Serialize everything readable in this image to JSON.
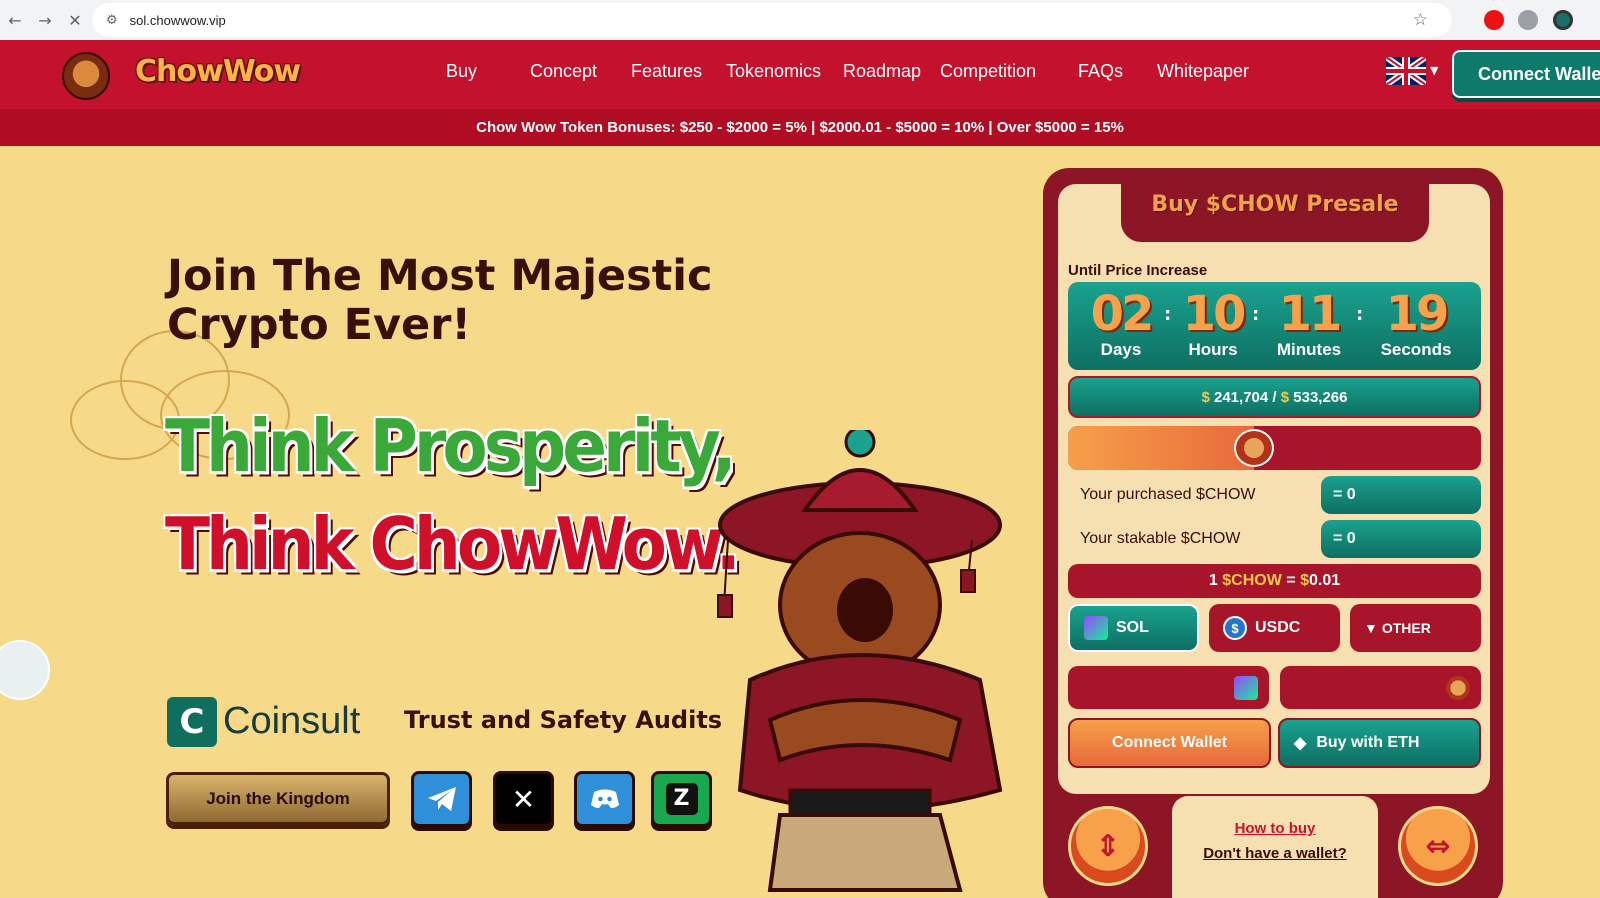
{
  "browser": {
    "url": "sol.chowwow.vip"
  },
  "header": {
    "logo_text": "ChowWow",
    "nav": [
      "Buy",
      "Concept",
      "Features",
      "Tokenomics",
      "Roadmap",
      "Competition",
      "FAQs",
      "Whitepaper"
    ],
    "connect_label": "Connect Wallet",
    "bonus_text": "Chow Wow Token Bonuses: $250 - $2000 = 5% | $2000.01 - $5000 = 10% | Over $5000 = 15%"
  },
  "hero": {
    "title": "Join The Most Majestic Crypto Ever!",
    "slogan_1": "Think Prosperity,",
    "slogan_2": "Think ChowWow.",
    "audit_brand": "Coinsult",
    "audit_text": "Trust and Safety Audits",
    "join_label": "Join the Kingdom",
    "socials": [
      "telegram",
      "x",
      "discord",
      "zealy"
    ]
  },
  "presale": {
    "title": "Buy $CHOW Presale",
    "until_label": "Until Price Increase",
    "countdown": [
      {
        "value": "02",
        "label": "Days"
      },
      {
        "value": "10",
        "label": "Hours"
      },
      {
        "value": "11",
        "label": "Minutes"
      },
      {
        "value": "19",
        "label": "Seconds"
      }
    ],
    "raised_symbol": "$",
    "raised": "241,704",
    "target": "533,266",
    "progress_fraction": 0.45,
    "purchased_label": "Your purchased $CHOW",
    "purchased_value": "= 0",
    "stakable_label": "Your stakable $CHOW",
    "stakable_value": "= 0",
    "price_prefix": "1",
    "price_token": "$CHOW",
    "price_eq": "=",
    "price_symbol": "$",
    "price_value": "0.01",
    "currencies": [
      {
        "label": "SOL",
        "icon": "solana-icon"
      },
      {
        "label": "USDC",
        "icon": "usdc-icon"
      },
      {
        "label": "OTHER",
        "icon": "caret-down-icon"
      }
    ],
    "connect_label": "Connect Wallet",
    "buy_eth_label": "Buy with ETH",
    "how_to_buy": "How to buy",
    "no_wallet": "Don't have a wallet?"
  },
  "colors": {
    "brand_red": "#c4122e",
    "teal": "#0e7a6c",
    "background": "#f7d98a",
    "orange": "#f5a04a"
  }
}
